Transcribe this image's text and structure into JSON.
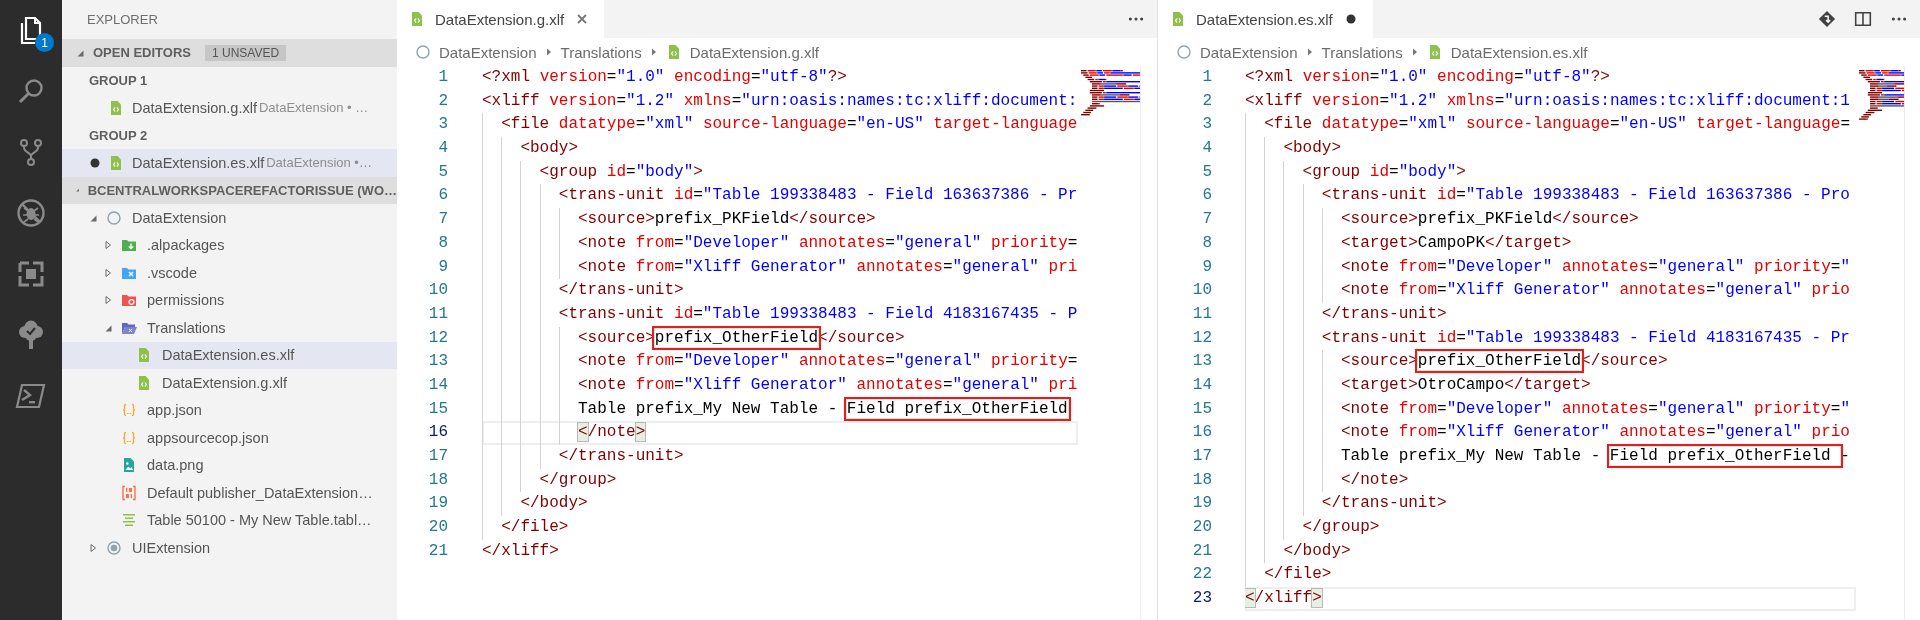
{
  "activity_bar": {
    "items": [
      {
        "kind": "explorer",
        "selected": true,
        "badge": "1"
      },
      {
        "kind": "search",
        "selected": false
      },
      {
        "kind": "source-control",
        "selected": false
      },
      {
        "kind": "debug",
        "selected": false
      },
      {
        "kind": "extensions",
        "selected": false
      },
      {
        "kind": "tree",
        "selected": false
      },
      {
        "kind": "terminal",
        "selected": false
      }
    ]
  },
  "sidebar": {
    "title": "EXPLORER",
    "open_editors": {
      "title": "OPEN EDITORS",
      "badge": "1 UNSAVED",
      "expanded": true,
      "groups": [
        {
          "title": "GROUP 1",
          "items": [
            {
              "name": "DataExtension.g.xlf",
              "description": "DataExtension • …",
              "kind": "xlf",
              "dirty": false,
              "selected": false
            }
          ]
        },
        {
          "title": "GROUP 2",
          "items": [
            {
              "name": "DataExtension.es.xlf",
              "description": "DataExtension •…",
              "kind": "xlf",
              "dirty": true,
              "selected": true
            }
          ]
        }
      ]
    },
    "workspace": {
      "title": "BCENTRALWORKSPACEREFACTORISSUE (WO…",
      "expanded": true,
      "tree": [
        {
          "label": "DataExtension",
          "kind": "project-empty",
          "expanded": true,
          "selected": false,
          "children": [
            {
              "label": ".alpackages",
              "kind": "folder-package",
              "expanded": false,
              "selected": false
            },
            {
              "label": ".vscode",
              "kind": "folder-vscode",
              "expanded": false,
              "selected": false
            },
            {
              "label": "permissions",
              "kind": "folder-permissions",
              "expanded": false,
              "selected": false
            },
            {
              "label": "Translations",
              "kind": "folder-translations",
              "expanded": true,
              "selected": false,
              "children": [
                {
                  "label": "DataExtension.es.xlf",
                  "kind": "xlf",
                  "selected": true
                },
                {
                  "label": "DataExtension.g.xlf",
                  "kind": "xlf",
                  "selected": false
                }
              ]
            },
            {
              "label": "app.json",
              "kind": "json",
              "selected": false
            },
            {
              "label": "appsourcecop.json",
              "kind": "json",
              "selected": false
            },
            {
              "label": "data.png",
              "kind": "image",
              "selected": false
            },
            {
              "label": "Default publisher_DataExtension…",
              "kind": "binary",
              "selected": false
            },
            {
              "label": "Table 50100 - My New Table.tabl…",
              "kind": "table",
              "selected": false
            }
          ]
        },
        {
          "label": "UIExtension",
          "kind": "project-dot",
          "expanded": false,
          "selected": false
        }
      ]
    }
  },
  "editors": [
    {
      "tab": {
        "name": "DataExtension.g.xlf",
        "kind": "xlf",
        "dirty": false
      },
      "actions": [
        {
          "kind": "more"
        }
      ],
      "breadcrumbs": [
        {
          "label": "DataExtension",
          "kind": "project-empty"
        },
        {
          "label": "Translations"
        },
        {
          "label": "DataExtension.g.xlf",
          "kind": "xlf"
        }
      ],
      "lines": [
        {
          "number": "1",
          "current": false,
          "code": [
            {
              "kind": "tag",
              "text": "<?xml"
            },
            {
              "kind": "attr",
              "text": " version"
            },
            {
              "kind": "punct",
              "text": "="
            },
            {
              "kind": "str",
              "text": "\"1.0\""
            },
            {
              "kind": "attr",
              "text": " encoding"
            },
            {
              "kind": "punct",
              "text": "="
            },
            {
              "kind": "str",
              "text": "\"utf-8\""
            },
            {
              "kind": "tag",
              "text": "?>"
            }
          ]
        },
        {
          "number": "2",
          "current": false,
          "code": [
            {
              "kind": "tag",
              "text": "<xliff"
            },
            {
              "kind": "attr",
              "text": " version"
            },
            {
              "kind": "punct",
              "text": "="
            },
            {
              "kind": "str",
              "text": "\"1.2\""
            },
            {
              "kind": "attr",
              "text": " xmlns"
            },
            {
              "kind": "punct",
              "text": "="
            },
            {
              "kind": "str",
              "text": "\"urn:oasis:names:tc:xliff:document:"
            }
          ]
        },
        {
          "number": "3",
          "current": false,
          "code": [
            {
              "kind": "tag",
              "text": "  <file"
            },
            {
              "kind": "attr",
              "text": " datatype"
            },
            {
              "kind": "punct",
              "text": "="
            },
            {
              "kind": "str",
              "text": "\"xml\""
            },
            {
              "kind": "attr",
              "text": " source-language"
            },
            {
              "kind": "punct",
              "text": "="
            },
            {
              "kind": "str",
              "text": "\"en-US\""
            },
            {
              "kind": "attr",
              "text": " target-language"
            }
          ]
        },
        {
          "number": "4",
          "current": false,
          "code": [
            {
              "kind": "tag",
              "text": "    <body>"
            }
          ]
        },
        {
          "number": "5",
          "current": false,
          "code": [
            {
              "kind": "tag",
              "text": "      <group"
            },
            {
              "kind": "attr",
              "text": " id"
            },
            {
              "kind": "punct",
              "text": "="
            },
            {
              "kind": "str",
              "text": "\"body\""
            },
            {
              "kind": "tag",
              "text": ">"
            }
          ]
        },
        {
          "number": "6",
          "current": false,
          "code": [
            {
              "kind": "tag",
              "text": "        <trans-unit"
            },
            {
              "kind": "attr",
              "text": " id"
            },
            {
              "kind": "punct",
              "text": "="
            },
            {
              "kind": "str",
              "text": "\"Table 199338483 - Field 163637386 - Pr"
            }
          ]
        },
        {
          "number": "7",
          "current": false,
          "code": [
            {
              "kind": "tag",
              "text": "          <source>"
            },
            {
              "kind": "text",
              "text": "prefix_PKField"
            },
            {
              "kind": "tag",
              "text": "</source>"
            }
          ]
        },
        {
          "number": "8",
          "current": false,
          "code": [
            {
              "kind": "tag",
              "text": "          <note"
            },
            {
              "kind": "attr",
              "text": " from"
            },
            {
              "kind": "punct",
              "text": "="
            },
            {
              "kind": "str",
              "text": "\"Developer\""
            },
            {
              "kind": "attr",
              "text": " annotates"
            },
            {
              "kind": "punct",
              "text": "="
            },
            {
              "kind": "str",
              "text": "\"general\""
            },
            {
              "kind": "attr",
              "text": " priority"
            },
            {
              "kind": "punct",
              "text": "="
            }
          ]
        },
        {
          "number": "9",
          "current": false,
          "code": [
            {
              "kind": "tag",
              "text": "          <note"
            },
            {
              "kind": "attr",
              "text": " from"
            },
            {
              "kind": "punct",
              "text": "="
            },
            {
              "kind": "str",
              "text": "\"Xliff Generator\""
            },
            {
              "kind": "attr",
              "text": " annotates"
            },
            {
              "kind": "punct",
              "text": "="
            },
            {
              "kind": "str",
              "text": "\"general\""
            },
            {
              "kind": "attr",
              "text": " pri"
            }
          ]
        },
        {
          "number": "10",
          "current": false,
          "code": [
            {
              "kind": "tag",
              "text": "        </trans-unit>"
            }
          ]
        },
        {
          "number": "11",
          "current": false,
          "code": [
            {
              "kind": "tag",
              "text": "        <trans-unit"
            },
            {
              "kind": "attr",
              "text": " id"
            },
            {
              "kind": "punct",
              "text": "="
            },
            {
              "kind": "str",
              "text": "\"Table 199338483 - Field 4183167435 - P"
            }
          ]
        },
        {
          "number": "12",
          "current": false,
          "code": [
            {
              "kind": "tag",
              "text": "          <source>"
            },
            {
              "kind": "text",
              "text": "prefix_OtherField",
              "boxed": true
            },
            {
              "kind": "tag",
              "text": "</source>"
            }
          ]
        },
        {
          "number": "13",
          "current": false,
          "code": [
            {
              "kind": "tag",
              "text": "          <note"
            },
            {
              "kind": "attr",
              "text": " from"
            },
            {
              "kind": "punct",
              "text": "="
            },
            {
              "kind": "str",
              "text": "\"Developer\""
            },
            {
              "kind": "attr",
              "text": " annotates"
            },
            {
              "kind": "punct",
              "text": "="
            },
            {
              "kind": "str",
              "text": "\"general\""
            },
            {
              "kind": "attr",
              "text": " priority"
            },
            {
              "kind": "punct",
              "text": "="
            }
          ]
        },
        {
          "number": "14",
          "current": false,
          "code": [
            {
              "kind": "tag",
              "text": "          <note"
            },
            {
              "kind": "attr",
              "text": " from"
            },
            {
              "kind": "punct",
              "text": "="
            },
            {
              "kind": "str",
              "text": "\"Xliff Generator\""
            },
            {
              "kind": "attr",
              "text": " annotates"
            },
            {
              "kind": "punct",
              "text": "="
            },
            {
              "kind": "str",
              "text": "\"general\""
            },
            {
              "kind": "attr",
              "text": " pri"
            }
          ]
        },
        {
          "number": "15",
          "current": false,
          "code": [
            {
              "kind": "text",
              "text": "          Table prefix_My New Table - "
            },
            {
              "kind": "text",
              "text": "Field prefix_OtherField",
              "boxed": true
            }
          ]
        },
        {
          "number": "16",
          "current": true,
          "code": [
            {
              "kind": "tag",
              "text": "          <",
              "bracket_match": true
            },
            {
              "kind": "tag",
              "text": "/note"
            },
            {
              "kind": "tag",
              "text": ">",
              "bracket_match": true
            }
          ]
        },
        {
          "number": "17",
          "current": false,
          "code": [
            {
              "kind": "tag",
              "text": "        </trans-unit>"
            }
          ]
        },
        {
          "number": "18",
          "current": false,
          "code": [
            {
              "kind": "tag",
              "text": "      </group>"
            }
          ]
        },
        {
          "number": "19",
          "current": false,
          "code": [
            {
              "kind": "tag",
              "text": "    </body>"
            }
          ]
        },
        {
          "number": "20",
          "current": false,
          "code": [
            {
              "kind": "tag",
              "text": "  </file>"
            }
          ]
        },
        {
          "number": "21",
          "current": false,
          "code": [
            {
              "kind": "tag",
              "text": "</xliff>"
            }
          ]
        }
      ]
    },
    {
      "tab": {
        "name": "DataExtension.es.xlf",
        "kind": "xlf",
        "dirty": true
      },
      "actions": [
        {
          "kind": "compare"
        },
        {
          "kind": "split"
        },
        {
          "kind": "more"
        }
      ],
      "breadcrumbs": [
        {
          "label": "DataExtension",
          "kind": "project-empty"
        },
        {
          "label": "Translations"
        },
        {
          "label": "DataExtension.es.xlf",
          "kind": "xlf"
        }
      ],
      "lines": [
        {
          "number": "1",
          "current": false,
          "code": [
            {
              "kind": "tag",
              "text": "<?xml"
            },
            {
              "kind": "attr",
              "text": " version"
            },
            {
              "kind": "punct",
              "text": "="
            },
            {
              "kind": "str",
              "text": "\"1.0\""
            },
            {
              "kind": "attr",
              "text": " encoding"
            },
            {
              "kind": "punct",
              "text": "="
            },
            {
              "kind": "str",
              "text": "\"utf-8\""
            },
            {
              "kind": "tag",
              "text": "?>"
            }
          ]
        },
        {
          "number": "2",
          "current": false,
          "code": [
            {
              "kind": "tag",
              "text": "<xliff"
            },
            {
              "kind": "attr",
              "text": " version"
            },
            {
              "kind": "punct",
              "text": "="
            },
            {
              "kind": "str",
              "text": "\"1.2\""
            },
            {
              "kind": "attr",
              "text": " xmlns"
            },
            {
              "kind": "punct",
              "text": "="
            },
            {
              "kind": "str",
              "text": "\"urn:oasis:names:tc:xliff:document:1"
            }
          ]
        },
        {
          "number": "3",
          "current": false,
          "code": [
            {
              "kind": "tag",
              "text": "  <file"
            },
            {
              "kind": "attr",
              "text": " datatype"
            },
            {
              "kind": "punct",
              "text": "="
            },
            {
              "kind": "str",
              "text": "\"xml\""
            },
            {
              "kind": "attr",
              "text": " source-language"
            },
            {
              "kind": "punct",
              "text": "="
            },
            {
              "kind": "str",
              "text": "\"en-US\""
            },
            {
              "kind": "attr",
              "text": " target-language"
            },
            {
              "kind": "punct",
              "text": "="
            }
          ]
        },
        {
          "number": "4",
          "current": false,
          "code": [
            {
              "kind": "tag",
              "text": "    <body>"
            }
          ]
        },
        {
          "number": "5",
          "current": false,
          "code": [
            {
              "kind": "tag",
              "text": "      <group"
            },
            {
              "kind": "attr",
              "text": " id"
            },
            {
              "kind": "punct",
              "text": "="
            },
            {
              "kind": "str",
              "text": "\"body\""
            },
            {
              "kind": "tag",
              "text": ">"
            }
          ]
        },
        {
          "number": "6",
          "current": false,
          "code": [
            {
              "kind": "tag",
              "text": "        <trans-unit"
            },
            {
              "kind": "attr",
              "text": " id"
            },
            {
              "kind": "punct",
              "text": "="
            },
            {
              "kind": "str",
              "text": "\"Table 199338483 - Field 163637386 - Pro"
            }
          ]
        },
        {
          "number": "7",
          "current": false,
          "code": [
            {
              "kind": "tag",
              "text": "          <source>"
            },
            {
              "kind": "text",
              "text": "prefix_PKField"
            },
            {
              "kind": "tag",
              "text": "</source>"
            }
          ]
        },
        {
          "number": "8",
          "current": false,
          "code": [
            {
              "kind": "tag",
              "text": "          <target>"
            },
            {
              "kind": "text",
              "text": "CampoPK"
            },
            {
              "kind": "tag",
              "text": "</target>"
            }
          ]
        },
        {
          "number": "9",
          "current": false,
          "code": [
            {
              "kind": "tag",
              "text": "          <note"
            },
            {
              "kind": "attr",
              "text": " from"
            },
            {
              "kind": "punct",
              "text": "="
            },
            {
              "kind": "str",
              "text": "\"Developer\""
            },
            {
              "kind": "attr",
              "text": " annotates"
            },
            {
              "kind": "punct",
              "text": "="
            },
            {
              "kind": "str",
              "text": "\"general\""
            },
            {
              "kind": "attr",
              "text": " priority"
            },
            {
              "kind": "punct",
              "text": "="
            },
            {
              "kind": "str",
              "text": "\""
            }
          ]
        },
        {
          "number": "10",
          "current": false,
          "code": [
            {
              "kind": "tag",
              "text": "          <note"
            },
            {
              "kind": "attr",
              "text": " from"
            },
            {
              "kind": "punct",
              "text": "="
            },
            {
              "kind": "str",
              "text": "\"Xliff Generator\""
            },
            {
              "kind": "attr",
              "text": " annotates"
            },
            {
              "kind": "punct",
              "text": "="
            },
            {
              "kind": "str",
              "text": "\"general\""
            },
            {
              "kind": "attr",
              "text": " prio"
            }
          ]
        },
        {
          "number": "11",
          "current": false,
          "code": [
            {
              "kind": "tag",
              "text": "        </trans-unit>"
            }
          ]
        },
        {
          "number": "12",
          "current": false,
          "code": [
            {
              "kind": "tag",
              "text": "        <trans-unit"
            },
            {
              "kind": "attr",
              "text": " id"
            },
            {
              "kind": "punct",
              "text": "="
            },
            {
              "kind": "str",
              "text": "\"Table 199338483 - Field 4183167435 - Pr"
            }
          ]
        },
        {
          "number": "13",
          "current": false,
          "code": [
            {
              "kind": "tag",
              "text": "          <source>"
            },
            {
              "kind": "text",
              "text": "prefix_OtherField",
              "boxed": true
            },
            {
              "kind": "tag",
              "text": "</source>"
            }
          ]
        },
        {
          "number": "14",
          "current": false,
          "code": [
            {
              "kind": "tag",
              "text": "          <target>"
            },
            {
              "kind": "text",
              "text": "OtroCampo"
            },
            {
              "kind": "tag",
              "text": "</target>"
            }
          ]
        },
        {
          "number": "15",
          "current": false,
          "code": [
            {
              "kind": "tag",
              "text": "          <note"
            },
            {
              "kind": "attr",
              "text": " from"
            },
            {
              "kind": "punct",
              "text": "="
            },
            {
              "kind": "str",
              "text": "\"Developer\""
            },
            {
              "kind": "attr",
              "text": " annotates"
            },
            {
              "kind": "punct",
              "text": "="
            },
            {
              "kind": "str",
              "text": "\"general\""
            },
            {
              "kind": "attr",
              "text": " priority"
            },
            {
              "kind": "punct",
              "text": "="
            },
            {
              "kind": "str",
              "text": "\""
            }
          ]
        },
        {
          "number": "16",
          "current": false,
          "code": [
            {
              "kind": "tag",
              "text": "          <note"
            },
            {
              "kind": "attr",
              "text": " from"
            },
            {
              "kind": "punct",
              "text": "="
            },
            {
              "kind": "str",
              "text": "\"Xliff Generator\""
            },
            {
              "kind": "attr",
              "text": " annotates"
            },
            {
              "kind": "punct",
              "text": "="
            },
            {
              "kind": "str",
              "text": "\"general\""
            },
            {
              "kind": "attr",
              "text": " prio"
            }
          ]
        },
        {
          "number": "17",
          "current": false,
          "code": [
            {
              "kind": "text",
              "text": "          Table prefix_My New Table - "
            },
            {
              "kind": "text",
              "text": "Field prefix_OtherField ",
              "boxed": true
            },
            {
              "kind": "text",
              "text": "-"
            }
          ]
        },
        {
          "number": "18",
          "current": false,
          "code": [
            {
              "kind": "tag",
              "text": "          </note>"
            }
          ]
        },
        {
          "number": "19",
          "current": false,
          "code": [
            {
              "kind": "tag",
              "text": "        </trans-unit>"
            }
          ]
        },
        {
          "number": "20",
          "current": false,
          "code": [
            {
              "kind": "tag",
              "text": "      </group>"
            }
          ]
        },
        {
          "number": "21",
          "current": false,
          "code": [
            {
              "kind": "tag",
              "text": "    </body>"
            }
          ]
        },
        {
          "number": "22",
          "current": false,
          "code": [
            {
              "kind": "tag",
              "text": "  </file>"
            }
          ]
        },
        {
          "number": "23",
          "current": true,
          "code": [
            {
              "kind": "tag",
              "text": "<",
              "bracket_match": true
            },
            {
              "kind": "tag",
              "text": "/xliff"
            },
            {
              "kind": "tag",
              "text": ">",
              "bracket_match": true
            }
          ]
        }
      ]
    }
  ]
}
